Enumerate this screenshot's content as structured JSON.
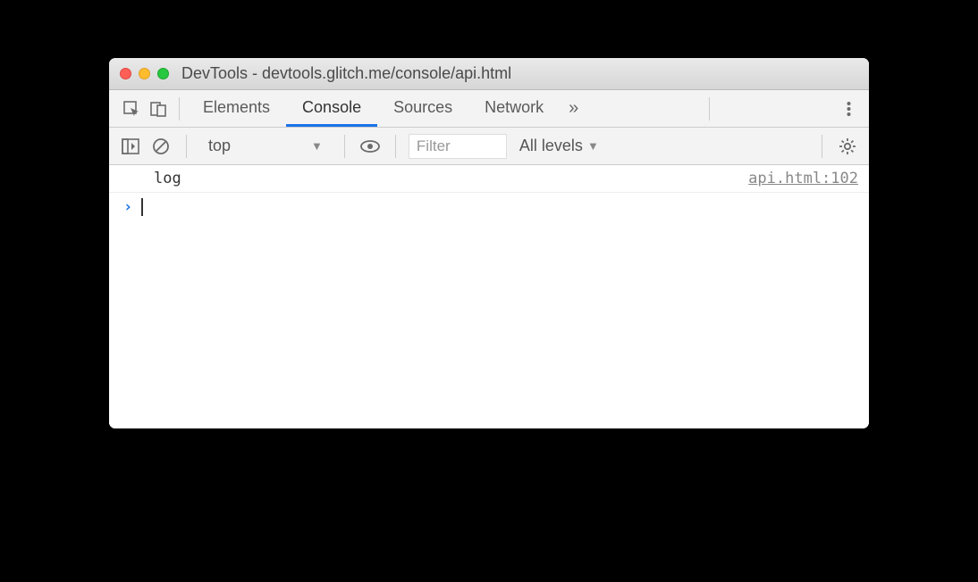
{
  "window": {
    "title": "DevTools - devtools.glitch.me/console/api.html"
  },
  "tabs": {
    "items": [
      "Elements",
      "Console",
      "Sources",
      "Network"
    ],
    "active": "Console",
    "overflow": "»"
  },
  "filterbar": {
    "context": "top",
    "filter_placeholder": "Filter",
    "levels": "All levels"
  },
  "console": {
    "entries": [
      {
        "message": "log",
        "source": "api.html:102"
      }
    ]
  }
}
